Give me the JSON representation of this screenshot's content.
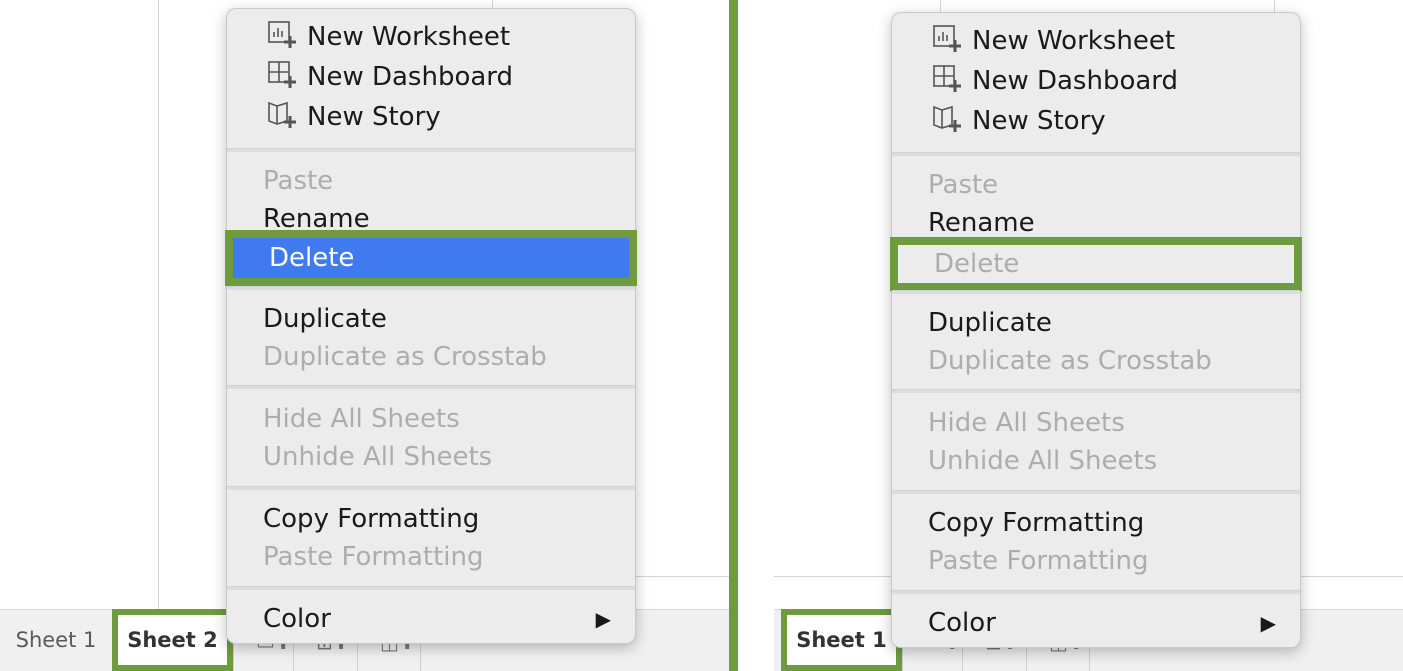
{
  "colors": {
    "highlight": "#3f7af0",
    "frame_green": "#6e9b3e",
    "menu_bg": "#ececec",
    "disabled_text": "#adadad"
  },
  "left": {
    "tabs": [
      {
        "label": "Sheet 1",
        "active": false
      },
      {
        "label": "Sheet 2",
        "active": true
      }
    ],
    "tab_icons": [
      "new-worksheet-icon",
      "new-dashboard-icon",
      "new-story-icon"
    ],
    "menu": {
      "new_group": [
        {
          "label": "New Worksheet",
          "icon": "new-worksheet-icon"
        },
        {
          "label": "New Dashboard",
          "icon": "new-dashboard-icon"
        },
        {
          "label": "New Story",
          "icon": "new-story-icon"
        }
      ],
      "paste": "Paste",
      "rename": "Rename",
      "delete": "Delete",
      "duplicate": "Duplicate",
      "duplicate_crosstab": "Duplicate as Crosstab",
      "hide_all": "Hide All Sheets",
      "unhide_all": "Unhide All Sheets",
      "copy_formatting": "Copy Formatting",
      "paste_formatting": "Paste Formatting",
      "color": "Color"
    }
  },
  "right": {
    "tabs": [
      {
        "label": "Sheet 1",
        "active": true
      }
    ],
    "menu": {
      "new_group": [
        {
          "label": "New Worksheet",
          "icon": "new-worksheet-icon"
        },
        {
          "label": "New Dashboard",
          "icon": "new-dashboard-icon"
        },
        {
          "label": "New Story",
          "icon": "new-story-icon"
        }
      ],
      "paste": "Paste",
      "rename": "Rename",
      "delete": "Delete",
      "duplicate": "Duplicate",
      "duplicate_crosstab": "Duplicate as Crosstab",
      "hide_all": "Hide All Sheets",
      "unhide_all": "Unhide All Sheets",
      "copy_formatting": "Copy Formatting",
      "paste_formatting": "Paste Formatting",
      "color": "Color"
    }
  }
}
